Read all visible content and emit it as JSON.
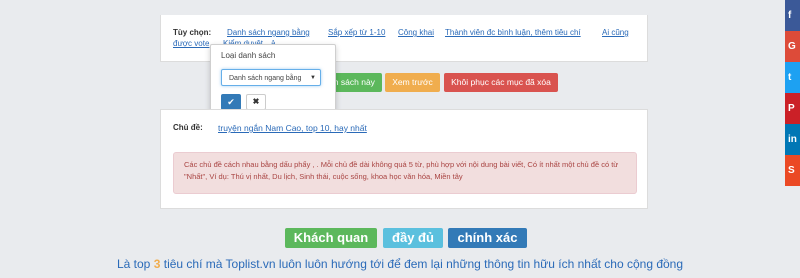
{
  "options": {
    "label": "Tùy chọn:",
    "links": [
      "Danh sách ngang bằng",
      "Sắp xếp từ 1-10",
      "Công khai",
      "Thành viên đc bình luận, thêm tiêu chí",
      "Ai cũng",
      "được vote",
      "Kiểm duyệt",
      "ả"
    ]
  },
  "popover": {
    "title": "Loại danh sách",
    "select_value": "Danh sách ngang bằng",
    "ok_icon": "check-icon",
    "cancel_icon": "close-icon",
    "ok_glyph": "✔",
    "cancel_glyph": "✖"
  },
  "actions": {
    "save_label": "nh sách này",
    "preview_label": "Xem trước",
    "restore_label": "Khôi phục các mục đã xóa"
  },
  "tags": {
    "label": "Chủ đề:",
    "value": "truyện ngắn Nam Cao, top 10, hay nhất",
    "alert": "Các chủ đề cách nhau bằng dấu phẩy , . Mỗi chủ đề dài không quá 5 từ, phù hợp với nội dung bài viết, Có ít nhất một chủ đề có từ \"Nhất\", Ví dụ: Thú vị nhất, Du lịch, Sinh thái, cuộc sống, khoa học văn hóa, Miền tây"
  },
  "criteria_tags": [
    "Khách quan",
    "đầy đủ",
    "chính xác"
  ],
  "footer": {
    "prefix": "Là top",
    "number": "3",
    "suffix": "tiêu chí mà Toplist.vn luôn luôn hướng tới để đem lại những thông tin hữu ích nhất cho cộng đồng"
  },
  "share": [
    {
      "icon": "facebook-icon",
      "glyph": "f",
      "color": "#3b5998"
    },
    {
      "icon": "google-plus-icon",
      "glyph": "G",
      "color": "#dd4b39"
    },
    {
      "icon": "twitter-icon",
      "glyph": "t",
      "color": "#1da1f2"
    },
    {
      "icon": "pinterest-icon",
      "glyph": "P",
      "color": "#cb2027"
    },
    {
      "icon": "linkedin-icon",
      "glyph": "in",
      "color": "#0077b5"
    },
    {
      "icon": "stumbleupon-icon",
      "glyph": "S",
      "color": "#eb4924"
    }
  ]
}
